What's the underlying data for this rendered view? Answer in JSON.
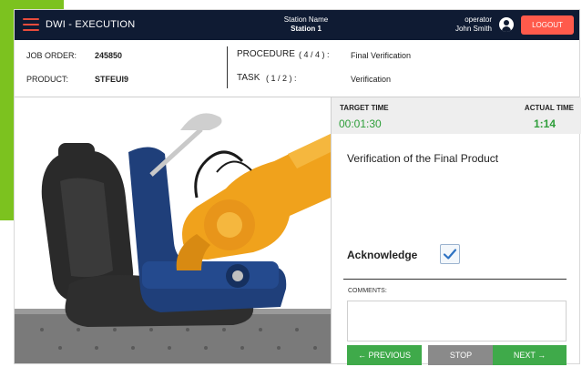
{
  "header": {
    "app_title": "DWI - EXECUTION",
    "station_label": "Station Name",
    "station_value": "Station 1",
    "operator_label": "operator",
    "operator_name": "John Smith",
    "logout_label": "LOGOUT"
  },
  "info": {
    "job_order_label": "JOB ORDER:",
    "job_order_value": "245850",
    "product_label": "PRODUCT:",
    "product_value": "STFEUI9",
    "procedure_label": "PROCEDURE",
    "procedure_count": "( 4 / 4 ) :",
    "procedure_value": "Final Verification",
    "task_label": "TASK",
    "task_count": "( 1 / 2 ) :",
    "task_value": "Verification"
  },
  "timing": {
    "target_label": "TARGET TIME",
    "target_value": "00:01:30",
    "actual_label": "ACTUAL TIME",
    "actual_value": "1:14"
  },
  "task": {
    "description": "Verification of the Final Product",
    "acknowledge_label": "Acknowledge",
    "acknowledged": true
  },
  "comments": {
    "label": "COMMENTS:",
    "value": ""
  },
  "buttons": {
    "previous": "← PREVIOUS",
    "stop": "STOP",
    "next": "NEXT →"
  },
  "colors": {
    "header_bg": "#0f1b33",
    "accent_red": "#ff5a4b",
    "accent_green": "#3faa4a",
    "time_green": "#2e9e3a",
    "robot_orange": "#f0a21c",
    "seat_dark": "#2a2a2a",
    "fixture_blue": "#1f3f7a"
  }
}
